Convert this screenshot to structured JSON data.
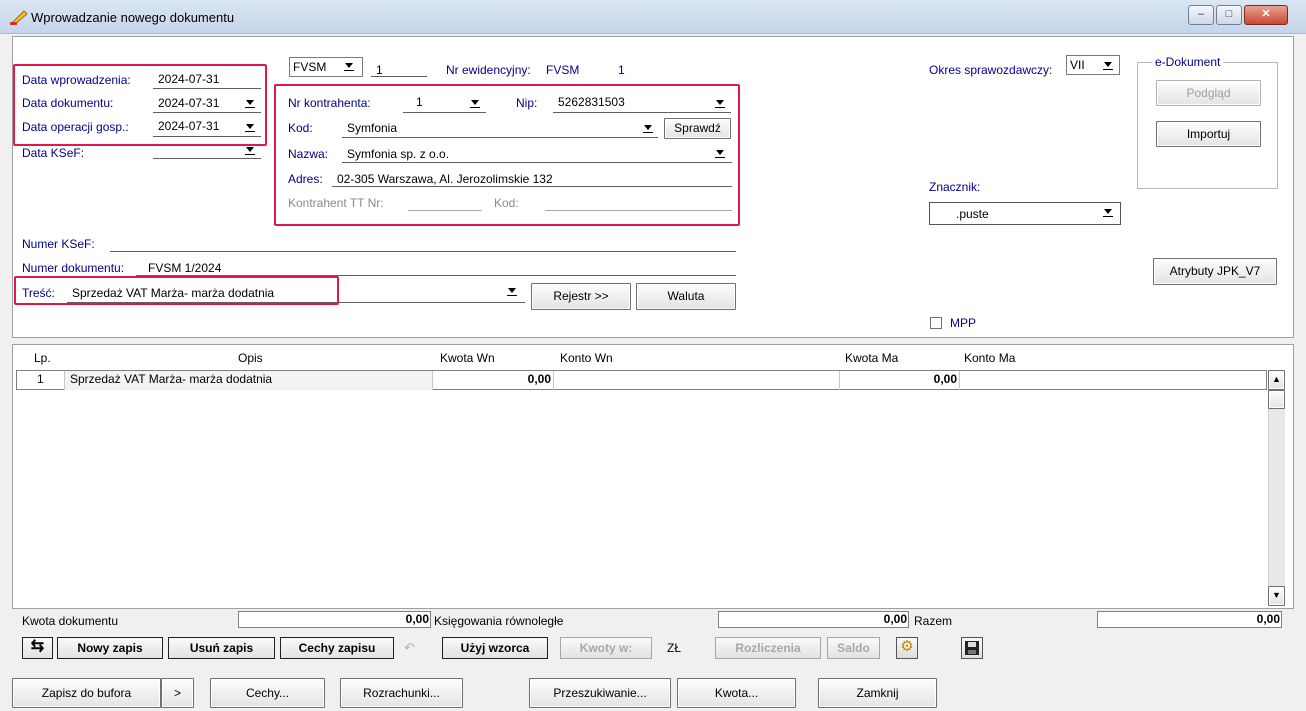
{
  "window": {
    "title": "Wprowadzanie nowego dokumentu",
    "accent": "#e0184e"
  },
  "header": {
    "doc_type": "FVSM",
    "doc_number": "1",
    "registry_label": "Nr ewidencyjny:",
    "registry_type": "FVSM",
    "registry_number": "1",
    "period_label": "Okres sprawozdawczy:",
    "period_value": "VII"
  },
  "dates": {
    "entry_label": "Data wprowadzenia:",
    "entry_value": "2024-07-31",
    "document_label": "Data dokumentu:",
    "document_value": "2024-07-31",
    "operation_label": "Data operacji gosp.:",
    "operation_value": "2024-07-31",
    "ksef_label": "Data KSeF:",
    "ksef_value": ""
  },
  "contractor": {
    "number_label": "Nr kontrahenta:",
    "number_value": "1",
    "nip_label": "Nip:",
    "nip_value": "5262831503",
    "code_label": "Kod:",
    "code_value": "Symfonia",
    "check_button": "Sprawdź",
    "name_label": "Nazwa:",
    "name_value": "Symfonia sp. z o.o.",
    "address_label": "Adres:",
    "address_value": "02-305 Warszawa, Al. Jerozolimskie 132",
    "tt_label": "Kontrahent TT Nr:",
    "tt_code_label": "Kod:"
  },
  "edocument": {
    "group_label": "e-Dokument",
    "preview_button": "Podgląd",
    "import_button": "Importuj"
  },
  "marker": {
    "label": "Znacznik:",
    "value": ".puste"
  },
  "ksef_number_label": "Numer KSeF:",
  "document_number_label": "Numer dokumentu:",
  "document_number_value": "FVSM 1/2024",
  "content_label": "Treść:",
  "content_value": "Sprzedaż VAT Marża- marża dodatnia",
  "register_button": "Rejestr >>",
  "currency_button": "Waluta",
  "jpk_button": "Atrybuty JPK_V7",
  "mpp_label": "MPP",
  "table": {
    "columns": [
      "Lp.",
      "Opis",
      "Kwota Wn",
      "Konto Wn",
      "Kwota Ma",
      "Konto Ma"
    ],
    "rows": [
      {
        "lp": "1",
        "opis": "Sprzedaż VAT Marża- marża dodatnia",
        "kwota_wn": "0,00",
        "konto_wn": "",
        "kwota_ma": "0,00",
        "konto_ma": ""
      }
    ]
  },
  "totals": {
    "doc_amount_label": "Kwota dokumentu",
    "doc_amount_value": "0,00",
    "parallel_label": "Księgowania równoległe",
    "parallel_value": "0,00",
    "sum_label": "Razem",
    "sum_value": "0,00"
  },
  "toolbar": {
    "new_entry": "Nowy zapis",
    "delete_entry": "Usuń zapis",
    "entry_features": "Cechy zapisu",
    "use_template": "Użyj wzorca",
    "amounts_in": "Kwoty w:",
    "currency": "ZŁ",
    "settlements": "Rozliczenia",
    "balance": "Saldo"
  },
  "footer": {
    "save_buffer": "Zapisz do bufora",
    "more": ">",
    "features": "Cechy...",
    "settlements": "Rozrachunki...",
    "search": "Przeszukiwanie...",
    "amount": "Kwota...",
    "close": "Zamknij"
  }
}
